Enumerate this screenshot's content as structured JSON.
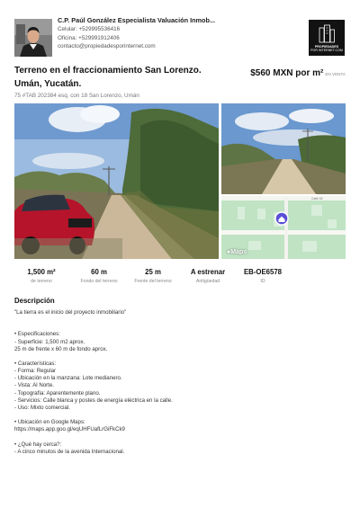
{
  "agent": {
    "name": "C.P. Paúl González Especialista Valuación Inmob...",
    "phone_line": "Celular: +529995536416",
    "office_line": "Oficina: +529991912406",
    "email": "contacto@propiedadesporinternet.com"
  },
  "logo": {
    "line1": "PROPIEDADES",
    "line2": "POR INTERNET.COM"
  },
  "listing": {
    "title_line1": "Terreno en el fraccionamiento San Lorenzo.",
    "title_line2": "Umán, Yucatán.",
    "price": "$560 MXN por m²",
    "price_tag": "EN VENTA",
    "address": "75 #TAB 202384 esq. con 18 San Lorenzo, Umán"
  },
  "map": {
    "badge": "Maps",
    "street_label": "Calle 18"
  },
  "stats": [
    {
      "value": "1,500 m²",
      "label": "de terreno"
    },
    {
      "value": "60 m",
      "label": "Fondo del terreno"
    },
    {
      "value": "25 m",
      "label": "Frente del terreno"
    },
    {
      "value": "A estrenar",
      "label": "Antigüedad"
    },
    {
      "value": "EB-OE6578",
      "label": "ID"
    }
  ],
  "description": {
    "title": "Descripción",
    "lines": [
      "\"La tierra es el inicio del proyecto inmobiliario\"",
      "",
      "",
      "• Especificaciones:",
      "- Superficie: 1,500 m2 aprox.",
      "25 m de frente x 60 m de fondo aprox.",
      "",
      "• Características:",
      "- Forma: Regular",
      "- Ubicación en la manzana: Lote medianero.",
      "- Vista: Al Norte.",
      "- Topografía: Aparentemente plano.",
      "- Servicios: Calle blanca y postes de energía eléctrica en la calle.",
      "- Uso: Mixto comercial.",
      "",
      "• Ubicación en Google Maps:",
      "https://maps.app.goo.gl/eqUHFUafLrGiFkCk9",
      "",
      "• ¿Qué hay cerca?:",
      "- A cinco minutos de la avenida Internacional."
    ]
  }
}
